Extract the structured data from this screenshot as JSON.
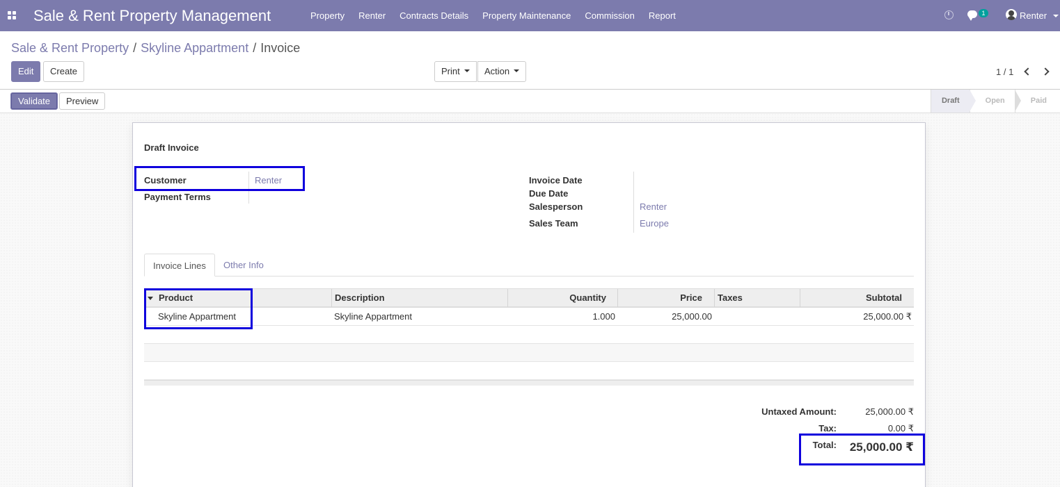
{
  "app": {
    "brand": "Sale & Rent Property Management",
    "menu": [
      "Property",
      "Renter",
      "Contracts Details",
      "Property Maintenance",
      "Commission",
      "Report"
    ],
    "chat_count": "1",
    "user_name": "Renter",
    "icons": {
      "apps": "apps-grid-icon",
      "activity": "clock-icon",
      "messages": "chat-icon",
      "avatar": "user-avatar-icon"
    },
    "colors": {
      "brand": "#7c7bad",
      "highlight": "#0f00dd",
      "badge": "#00a09d"
    }
  },
  "breadcrumb": {
    "items": [
      "Sale & Rent Property",
      "Skyline Appartment"
    ],
    "current": "Invoice",
    "separator": "/"
  },
  "toolbar": {
    "edit_label": "Edit",
    "create_label": "Create",
    "print_label": "Print",
    "action_label": "Action",
    "pager_value": "1 / 1"
  },
  "header": {
    "validate_label": "Validate",
    "preview_label": "Preview",
    "stages": [
      "Draft",
      "Open",
      "Paid"
    ],
    "active_stage": "Draft"
  },
  "invoice": {
    "title": "Draft Invoice",
    "customer_label": "Customer",
    "customer_value": "Renter",
    "payment_terms_label": "Payment Terms",
    "invoice_date_label": "Invoice Date",
    "due_date_label": "Due Date",
    "salesperson_label": "Salesperson",
    "salesperson_value": "Renter",
    "sales_team_label": "Sales Team",
    "sales_team_value": "Europe"
  },
  "tabs": [
    "Invoice Lines",
    "Other Info"
  ],
  "lines": {
    "columns": [
      "Product",
      "Description",
      "Quantity",
      "Price",
      "Taxes",
      "Subtotal"
    ],
    "rows": [
      {
        "product": "Skyline Appartment",
        "description": "Skyline Appartment",
        "quantity": "1.000",
        "price": "25,000.00",
        "taxes": "",
        "subtotal": "25,000.00 ₹"
      }
    ]
  },
  "totals": {
    "untaxed_label": "Untaxed Amount:",
    "untaxed_value": "25,000.00 ₹",
    "tax_label": "Tax:",
    "tax_value": "0.00 ₹",
    "total_label": "Total:",
    "total_value": "25,000.00 ₹"
  }
}
